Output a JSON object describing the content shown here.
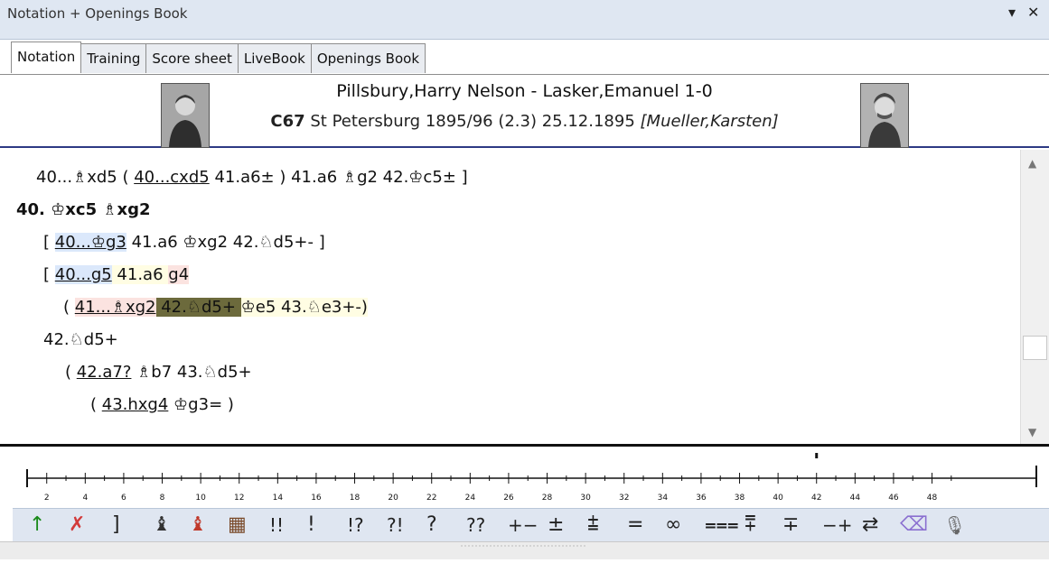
{
  "window": {
    "title": "Notation + Openings Book",
    "menu_arrow": "▾",
    "close": "✕"
  },
  "tabs": [
    "Notation",
    "Training",
    "Score sheet",
    "LiveBook",
    "Openings Book"
  ],
  "header": {
    "players": "Pillsbury,Harry Nelson - Lasker,Emanuel  1-0",
    "eco": "C67",
    "event": "St Petersburg 1895/96 (2.3) 25.12.1895",
    "annotator": "[Mueller,Karsten]"
  },
  "notation": {
    "l1": {
      "a": "40...♗xd5  (",
      "b": "40...cxd5",
      "c": " 41.a6± ) 41.a6  ♗g2  42.♔c5± ]"
    },
    "l2": {
      "a": "40.",
      "b": "♔xc5  ♗xg2"
    },
    "l3": {
      "a": "[ ",
      "b": "40...♔g3",
      "c": " 41.a6  ♔xg2  42.♘d5+- ]"
    },
    "l4": {
      "a": "[ ",
      "b": "40...g5",
      "c": " 41.a6 ",
      "d": "g4"
    },
    "l5": {
      "a": "( ",
      "b": "41...♗xg2",
      "c": " 42.♘d5+ ",
      "d": "♔e5  43.♘e3+-)"
    },
    "l6": {
      "a": "42.♘d5+"
    },
    "l7": {
      "a": "( ",
      "b": "42.a7?",
      "c": "  ♗b7  43.♘d5+"
    },
    "l8": {
      "a": "( ",
      "b": "43.hxg4",
      "c": "  ♔g3= )"
    }
  },
  "scrollbar": {
    "up": "▲",
    "down": "▼"
  },
  "ruler": {
    "labels": [
      "2",
      "4",
      "6",
      "8",
      "10",
      "12",
      "14",
      "16",
      "18",
      "20",
      "22",
      "24",
      "26",
      "28",
      "30",
      "32",
      "34",
      "36",
      "38",
      "40",
      "42",
      "44",
      "46",
      "48"
    ],
    "current_move": 42
  },
  "toolbar": [
    {
      "name": "promote-variation-icon",
      "label": "↑"
    },
    {
      "name": "delete-icon",
      "label": "✗"
    },
    {
      "name": "bracket-icon",
      "label": "]"
    },
    {
      "name": "white-piece-icon",
      "label": "♝"
    },
    {
      "name": "black-piece-icon",
      "label": "♝"
    },
    {
      "name": "board-diagram-icon",
      "label": "▦"
    },
    {
      "name": "brilliant-move",
      "label": "!!"
    },
    {
      "name": "good-move",
      "label": "!"
    },
    {
      "name": "interesting-move",
      "label": "!?"
    },
    {
      "name": "dubious-move",
      "label": "?!"
    },
    {
      "name": "mistake",
      "label": "?"
    },
    {
      "name": "blunder",
      "label": "??"
    },
    {
      "name": "white-winning",
      "label": "+−"
    },
    {
      "name": "white-better",
      "label": "±"
    },
    {
      "name": "white-slightly-better",
      "label": "⩲"
    },
    {
      "name": "equal",
      "label": "="
    },
    {
      "name": "unclear",
      "label": "∞"
    },
    {
      "name": "with-compensation",
      "label": "⩶"
    },
    {
      "name": "black-slightly-better",
      "label": "⩱"
    },
    {
      "name": "black-better",
      "label": "∓"
    },
    {
      "name": "black-winning",
      "label": "−+"
    },
    {
      "name": "counterplay",
      "label": "⇄"
    },
    {
      "name": "eraser-icon",
      "label": "⌫"
    },
    {
      "name": "microphone-icon",
      "label": "🎙"
    }
  ]
}
